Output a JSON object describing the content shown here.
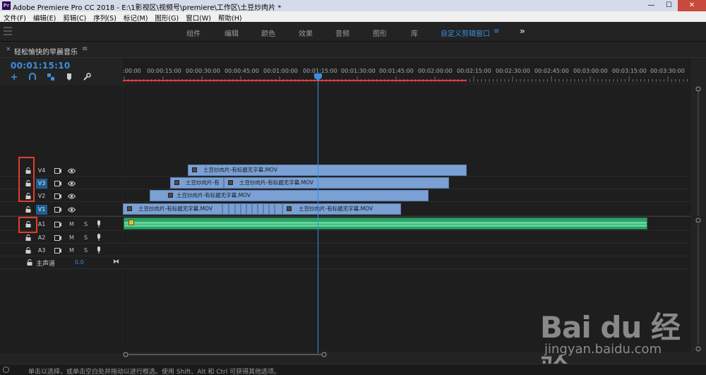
{
  "window": {
    "title": "Adobe Premiere Pro CC 2018 - E:\\1影视区\\视频号\\premiere\\工作区\\土豆炒肉片 *",
    "app_badge": "Pr",
    "minimize": "—",
    "maximize": "☐",
    "close": "✕"
  },
  "menu": [
    "文件(F)",
    "编辑(E)",
    "剪辑(C)",
    "序列(S)",
    "标记(M)",
    "图形(G)",
    "窗口(W)",
    "帮助(H)"
  ],
  "workspaces": {
    "tabs": [
      "组件",
      "编辑",
      "颜色",
      "效果",
      "音频",
      "图形",
      "库",
      "自定义剪辑窗口"
    ],
    "active": "自定义剪辑窗口",
    "menu_glyph": "≡",
    "more_glyph": "»"
  },
  "panel": {
    "close_glyph": "×",
    "title": "轻松愉快的早晨音乐",
    "menu_glyph": "≡"
  },
  "timeline": {
    "timecode": "00:01:15:10",
    "ruler_labels": [
      ":00:00",
      "00:00:15:00",
      "00:00:30:00",
      "00:00:45:00",
      "00:01:00:00",
      "00:01:15:00",
      "00:01:30:00",
      "00:01:45:00",
      "00:02:00:00",
      "00:02:15:00",
      "00:02:30:00",
      "00:02:45:00",
      "00:03:00:00",
      "00:03:15:00",
      "00:03:30:00"
    ],
    "video_tracks": [
      {
        "name": "V4",
        "active": false
      },
      {
        "name": "V3",
        "active": true
      },
      {
        "name": "V2",
        "active": false
      },
      {
        "name": "V1",
        "active": true
      }
    ],
    "audio_tracks": [
      {
        "name": "A1",
        "m": "M",
        "s": "S"
      },
      {
        "name": "A2",
        "m": "M",
        "s": "S"
      },
      {
        "name": "A3",
        "m": "M",
        "s": "S"
      }
    ],
    "master": {
      "label": "主声道",
      "value": "0.0",
      "icon": "⧓"
    },
    "clip_label": "土豆炒肉片-有标题无字幕.MOV",
    "clip_label_short": "土豆炒肉片-有",
    "clip_fx": "fx"
  },
  "status": {
    "text": "单击以选择，或单击空白处并拖动以进行框选。使用 Shift、Alt 和 Ctrl 可获得其他选项。"
  },
  "watermark": {
    "logo": "Bai du 经验",
    "url": "jingyan.baidu.com"
  },
  "colors": {
    "accent": "#3b8fe0",
    "video_clip": "#7aa0d4",
    "audio_clip": "#2ea168",
    "highlight_box": "#e23c2c",
    "work_area": "#e8393c"
  }
}
